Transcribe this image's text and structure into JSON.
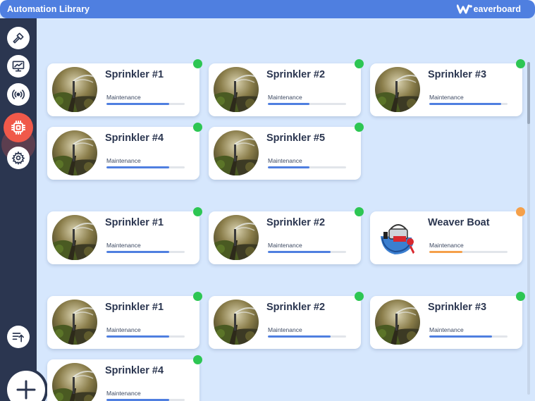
{
  "app": {
    "title": "Automation Library",
    "brand": "eaverboard",
    "colors": {
      "topbar": "#4f7fe0",
      "sidebar": "#2b3650",
      "canvas": "#d6e7fd",
      "active": "#f0594a",
      "status_ok": "#2dc653",
      "status_warn": "#f5a04a",
      "bar_blue": "#4f7fe0",
      "bar_orange": "#f5a04a"
    }
  },
  "sidebar": {
    "items": [
      {
        "icon": "hammer-icon",
        "active": false
      },
      {
        "icon": "presentation-chart-icon",
        "active": false
      },
      {
        "icon": "broadcast-icon",
        "active": false
      },
      {
        "icon": "cpu-chip-icon",
        "active": true
      },
      {
        "icon": "gear-icon",
        "active": false
      }
    ],
    "bottom_icon": "sort-upload-icon",
    "add_icon": "plus-icon"
  },
  "groups": [
    {
      "cards": [
        {
          "name": "Sprinkler #1",
          "label": "Maintenance",
          "progress": 0.8,
          "status": "ok",
          "image": "sprinkler"
        },
        {
          "name": "Sprinkler #2",
          "label": "Maintenance",
          "progress": 0.53,
          "status": "ok",
          "image": "sprinkler"
        },
        {
          "name": "Sprinkler #3",
          "label": "Maintenance",
          "progress": 0.92,
          "status": "ok",
          "image": "sprinkler"
        },
        {
          "name": "Sprinkler #4",
          "label": "Maintenance",
          "progress": 0.8,
          "status": "ok",
          "image": "sprinkler"
        },
        {
          "name": "Sprinkler #5",
          "label": "Maintenance",
          "progress": 0.53,
          "status": "ok",
          "image": "sprinkler"
        }
      ]
    },
    {
      "cards": [
        {
          "name": "Sprinkler #1",
          "label": "Maintenance",
          "progress": 0.8,
          "status": "ok",
          "image": "sprinkler"
        },
        {
          "name": "Sprinkler #2",
          "label": "Maintenance",
          "progress": 0.8,
          "status": "ok",
          "image": "sprinkler"
        },
        {
          "name": "Weaver Boat",
          "label": "Maintenance",
          "progress": 0.42,
          "status": "warn",
          "image": "boat"
        }
      ]
    },
    {
      "cards": [
        {
          "name": "Sprinkler #1",
          "label": "Maintenance",
          "progress": 0.8,
          "status": "ok",
          "image": "sprinkler"
        },
        {
          "name": "Sprinkler #2",
          "label": "Maintenance",
          "progress": 0.8,
          "status": "ok",
          "image": "sprinkler"
        },
        {
          "name": "Sprinkler #3",
          "label": "Maintenance",
          "progress": 0.8,
          "status": "ok",
          "image": "sprinkler"
        },
        {
          "name": "Sprinkler #4",
          "label": "Maintenance",
          "progress": 0.8,
          "status": "ok",
          "image": "sprinkler"
        }
      ]
    }
  ]
}
